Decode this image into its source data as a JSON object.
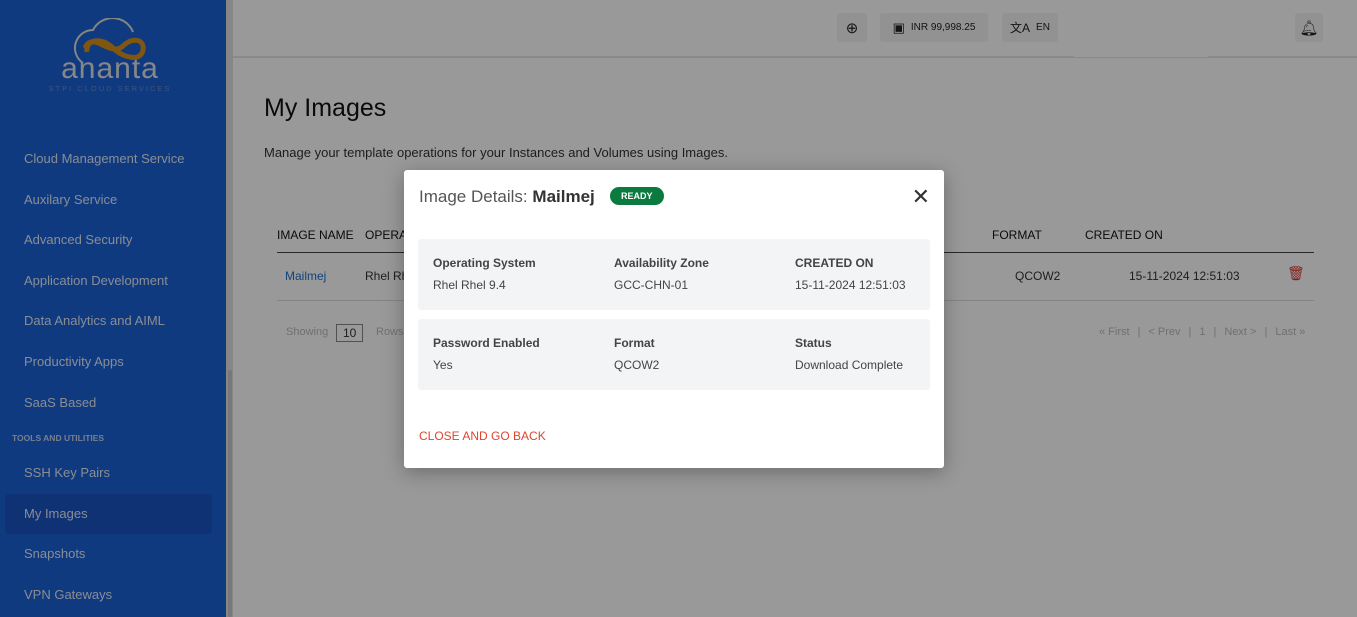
{
  "sidebar": {
    "logo_word": "ananta",
    "logo_sub": "STPI CLOUD SERVICES",
    "items": [
      "Cloud Management Service",
      "Auxilary Service",
      "Advanced Security",
      "Application Development",
      "Data Analytics and AIML",
      "Productivity Apps",
      "SaaS Based"
    ],
    "section": "TOOLS AND UTILITIES",
    "tools": [
      "SSH Key Pairs",
      "My Images",
      "Snapshots",
      "VPN Gateways"
    ],
    "active": "My Images"
  },
  "topbar": {
    "balance": "INR 99,998.25",
    "language": "EN"
  },
  "page": {
    "title": "My Images",
    "description": "Manage your template operations for your Instances and Volumes using Images."
  },
  "table": {
    "headers": [
      "IMAGE NAME",
      "OPERA",
      "FORMAT",
      "CREATED ON"
    ],
    "row": {
      "name": "Mailmej",
      "os": "Rhel Rh",
      "format": "QCOW2",
      "created": "15-11-2024 12:51:03"
    },
    "showing": "Showing",
    "rows_value": "10",
    "rows_label": "Rows",
    "pager": {
      "first": "« First",
      "prev": "< Prev",
      "page": "1",
      "next": "Next >",
      "last": "Last »"
    }
  },
  "modal": {
    "title_prefix": "Image Details:",
    "title_name": "Mailmej",
    "status": "READY",
    "fields": [
      {
        "label": "Operating System",
        "value": "Rhel Rhel 9.4"
      },
      {
        "label": "Availability Zone",
        "value": "GCC-CHN-01"
      },
      {
        "label": "CREATED ON",
        "value": "15-11-2024 12:51:03"
      },
      {
        "label": "Password Enabled",
        "value": "Yes"
      },
      {
        "label": "Format",
        "value": "QCOW2"
      },
      {
        "label": "Status",
        "value": "Download Complete"
      }
    ],
    "close_back": "CLOSE AND GO BACK"
  },
  "colors": {
    "sidebar": "#1961d6",
    "ready": "#0a7a3e",
    "danger": "#e0442d",
    "link": "#1f6fd1"
  }
}
